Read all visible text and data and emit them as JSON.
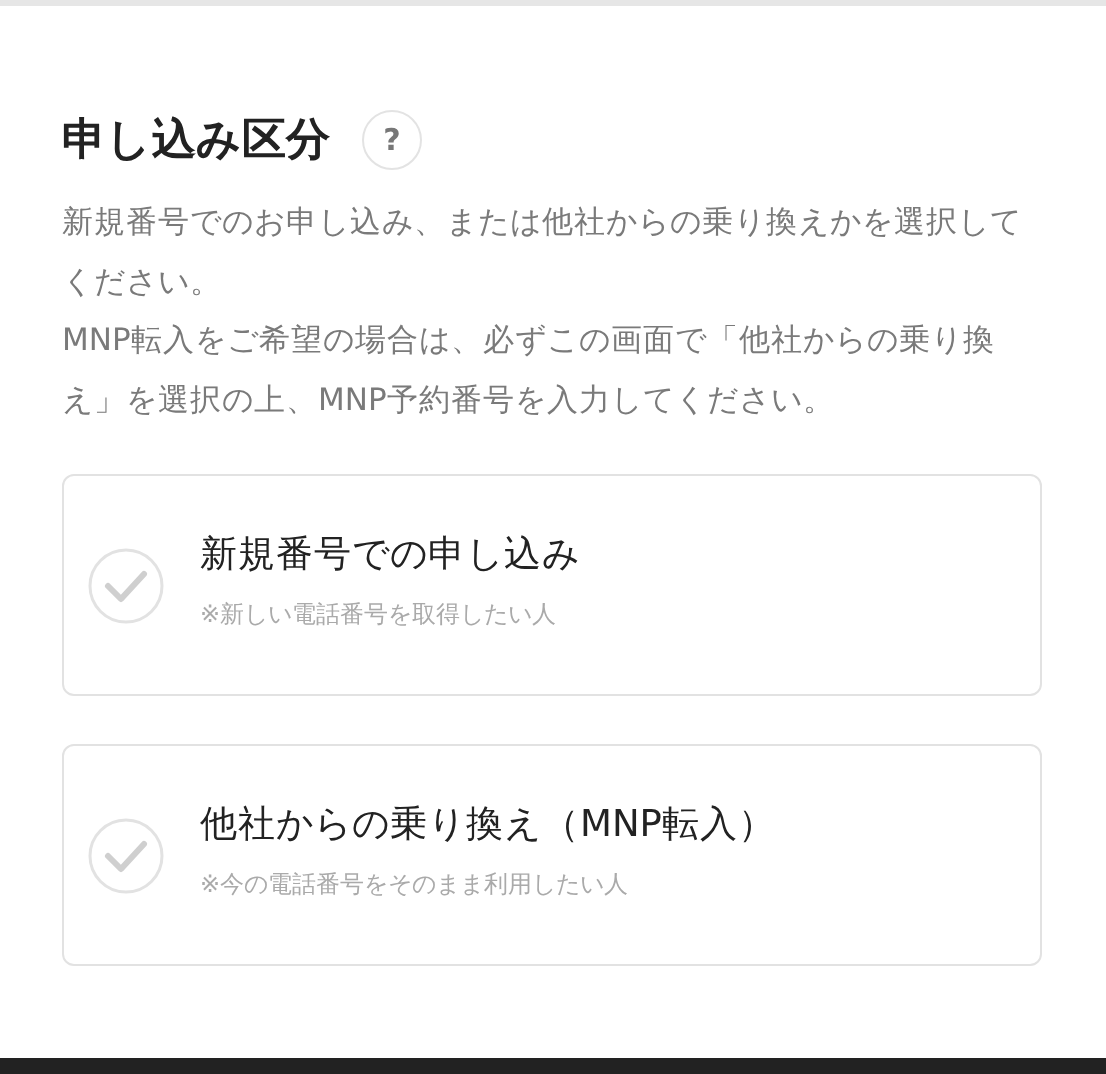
{
  "section": {
    "title": "申し込み区分",
    "help_icon": "?",
    "description": [
      "新規番号でのお申し込み、または他社からの乗り換えかを選択してください。",
      "MNP転入をご希望の場合は、必ずこの画面で「他社からの乗り換え」を選択の上、MNP予約番号を入力してください。"
    ]
  },
  "options": [
    {
      "label": "新規番号での申し込み",
      "note": "※新しい電話番号を取得したい人",
      "selected": false
    },
    {
      "label": "他社からの乗り換え（MNP転入）",
      "note": "※今の電話番号をそのまま利用したい人",
      "selected": false
    }
  ]
}
